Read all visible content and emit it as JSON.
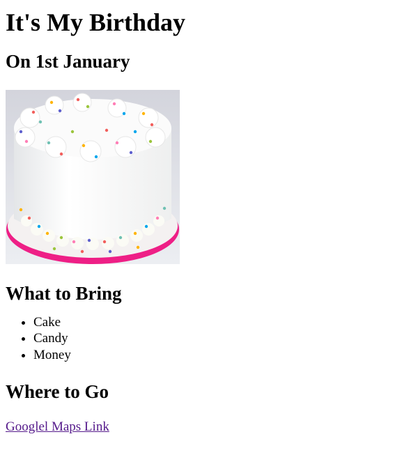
{
  "page": {
    "title": "It's My Birthday",
    "date_heading": "On 1st January"
  },
  "image": {
    "alt": "Birthday cake",
    "colors": {
      "background": "#dcdde3",
      "frosting": "#f8f8f6",
      "ribbon": "#ee1f86"
    }
  },
  "bring": {
    "heading": "What to Bring",
    "items": [
      "Cake",
      "Candy",
      "Money"
    ]
  },
  "where": {
    "heading": "Where to Go",
    "link_text": "Googlel Maps Link"
  }
}
